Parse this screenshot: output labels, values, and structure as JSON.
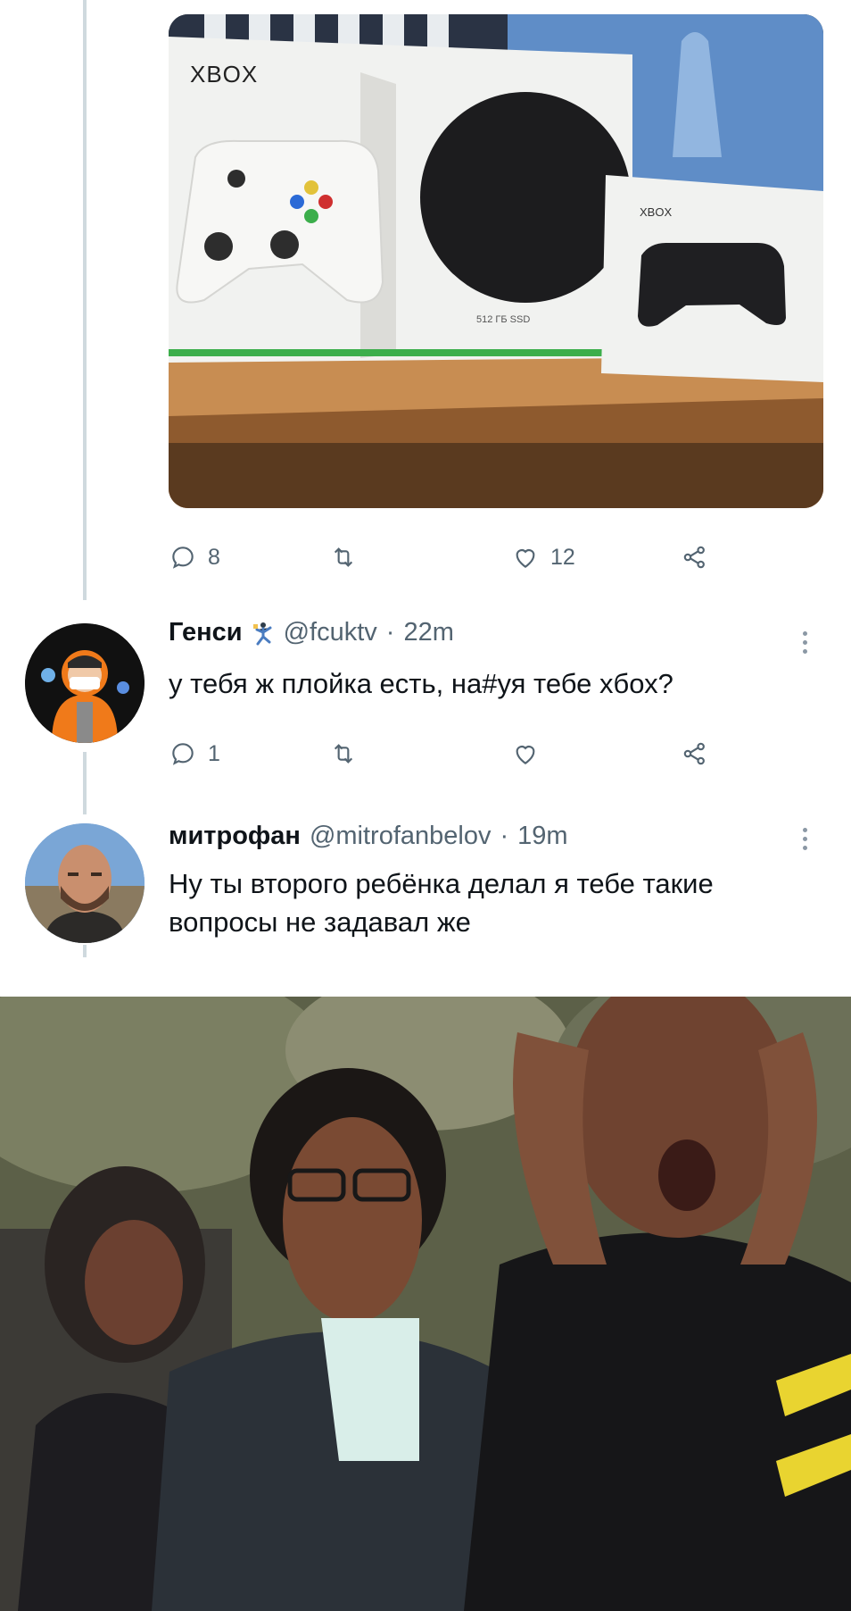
{
  "first_tweet": {
    "media_alt_icon": "xbox-series-s-box-photo",
    "box_logo_text": "XBOX",
    "controller_box_logo_text": "XBOX",
    "storage_text": "512 ГБ SSD",
    "actions": {
      "reply_count": "8",
      "retweet_count": "",
      "like_count": "12"
    }
  },
  "replies": [
    {
      "name": "Генси",
      "badge_icon": "dancing-person-emoji",
      "handle": "@fcuktv",
      "separator": "·",
      "time": "22m",
      "text": "у тебя ж плойка есть, на#уя тебе xбох?",
      "actions": {
        "reply_count": "1",
        "retweet_count": "",
        "like_count": ""
      }
    },
    {
      "name": "митрофан",
      "handle": "@mitrofanbelov",
      "separator": "·",
      "time": "19m",
      "text_line1": "Ну ты второго ребёнка делал я тебе такие",
      "text_line2": "вопросы не задавал же"
    }
  ],
  "meme_image": "shocked-reaction-meme-photo",
  "colors": {
    "icon_gray": "#536471",
    "thread_line": "#cfd9de",
    "text": "#0f1419"
  }
}
